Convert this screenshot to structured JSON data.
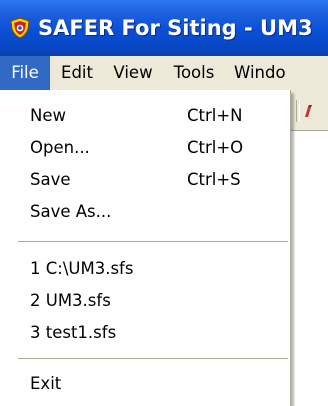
{
  "window": {
    "title": "SAFER For Siting - UM3"
  },
  "menubar": {
    "items": [
      {
        "label": "File",
        "active": true
      },
      {
        "label": "Edit",
        "active": false
      },
      {
        "label": "View",
        "active": false
      },
      {
        "label": "Tools",
        "active": false
      },
      {
        "label": "Windo",
        "active": false
      }
    ]
  },
  "file_menu": {
    "items": [
      {
        "label": "New",
        "shortcut": "Ctrl+N"
      },
      {
        "label": "Open...",
        "shortcut": "Ctrl+O"
      },
      {
        "label": "Save",
        "shortcut": "Ctrl+S"
      },
      {
        "label": "Save As...",
        "shortcut": ""
      },
      {
        "label": "1 C:\\UM3.sfs",
        "shortcut": ""
      },
      {
        "label": "2 UM3.sfs",
        "shortcut": ""
      },
      {
        "label": "3 test1.sfs",
        "shortcut": ""
      },
      {
        "label": "Exit",
        "shortcut": ""
      }
    ]
  },
  "colors": {
    "titlebar": "#0a4fd6",
    "menu_highlight": "#316ac5",
    "menubar_bg": "#ece9d8",
    "menu_bg": "#ffffff",
    "separator": "#aca899"
  },
  "icons": {
    "app": "shield-icon",
    "toolbar_partial": "toolbar-button-icon"
  }
}
